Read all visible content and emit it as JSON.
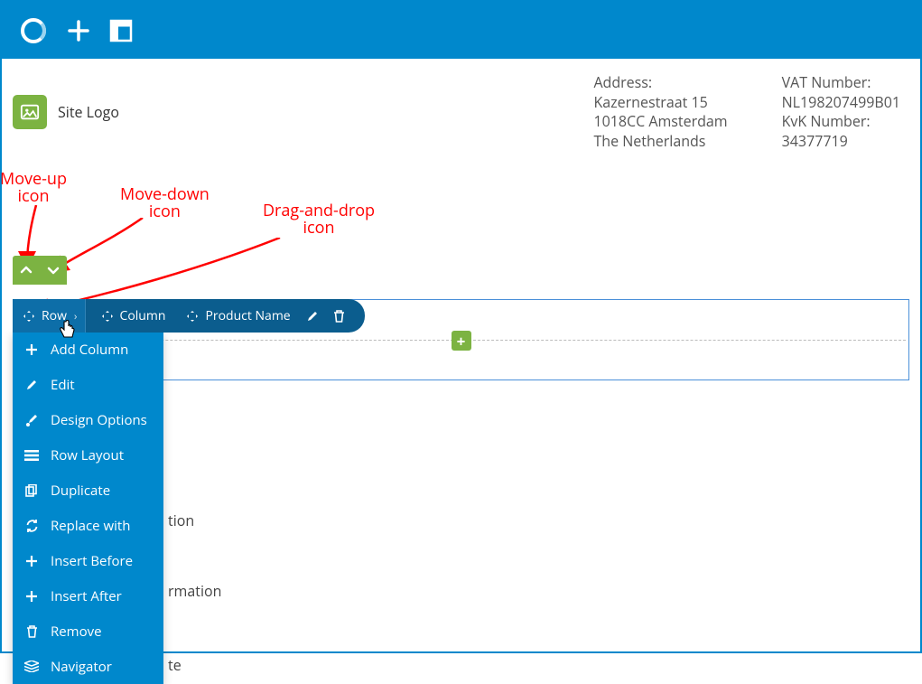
{
  "topbar": {
    "brand": "brand",
    "add": "add",
    "layout": "layout"
  },
  "header": {
    "site_logo_label": "Site Logo",
    "address": {
      "label": "Address:",
      "line1": "Kazernestraat 15",
      "line2": "1018CC Amsterdam",
      "line3": "The Netherlands"
    },
    "vat_label": "VAT Number:",
    "vat_value": "NL198207499B01",
    "kvk_label": "KvK Number:",
    "kvk_value": "34377719"
  },
  "annotations": {
    "moveup": "Move-up\nicon",
    "movedown": "Move-down\nicon",
    "dragdrop": "Drag-and-drop\nicon"
  },
  "context_bar": {
    "row": "Row",
    "column": "Column",
    "product_name": "Product Name"
  },
  "dropdown": {
    "items": [
      {
        "icon": "plus-icon",
        "label": "Add Column"
      },
      {
        "icon": "pencil-icon",
        "label": "Edit"
      },
      {
        "icon": "brush-icon",
        "label": "Design Options"
      },
      {
        "icon": "rowlayout-icon",
        "label": "Row Layout"
      },
      {
        "icon": "duplicate-icon",
        "label": "Duplicate"
      },
      {
        "icon": "replace-icon",
        "label": "Replace with"
      },
      {
        "icon": "plus-icon",
        "label": "Insert Before"
      },
      {
        "icon": "plus-icon",
        "label": "Insert After"
      },
      {
        "icon": "trash-icon",
        "label": "Remove"
      },
      {
        "icon": "navigator-icon",
        "label": "Navigator"
      }
    ]
  },
  "bg_labels": {
    "l1": "tion",
    "l2": "rmation",
    "l3": "te"
  }
}
